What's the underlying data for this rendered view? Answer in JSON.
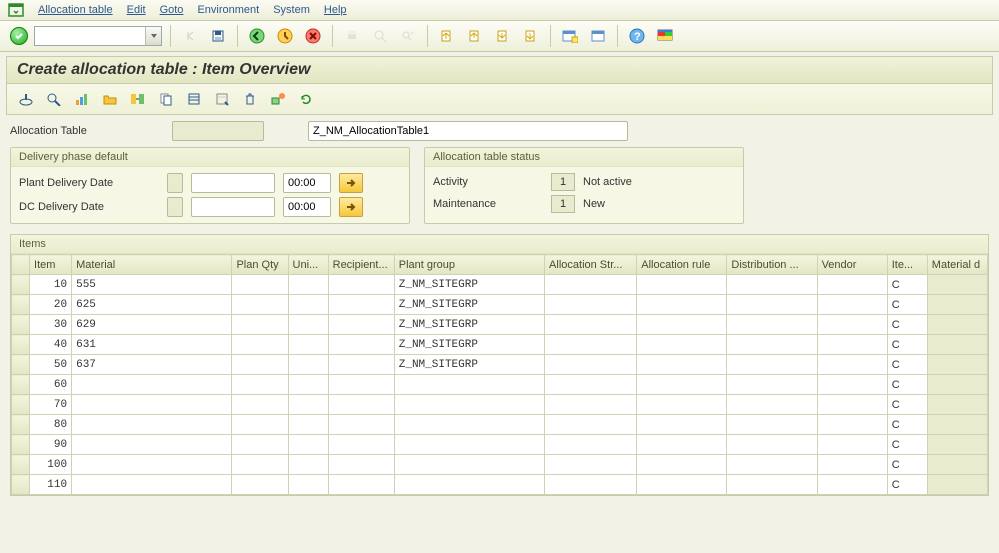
{
  "menu": {
    "items": [
      "Allocation table",
      "Edit",
      "Goto",
      "Environment",
      "System",
      "Help"
    ]
  },
  "toolbar": {
    "combo_value": ""
  },
  "title": "Create allocation table : Item Overview",
  "header": {
    "alloc_table_label": "Allocation Table",
    "alloc_table_code": "",
    "alloc_table_desc": "Z_NM_AllocationTable1"
  },
  "delivery_group": {
    "title": "Delivery phase default",
    "rows": [
      {
        "label": "Plant Delivery Date",
        "date": "",
        "time": "00:00"
      },
      {
        "label": "DC Delivery Date",
        "date": "",
        "time": "00:00"
      }
    ]
  },
  "status_group": {
    "title": "Allocation table status",
    "rows": [
      {
        "label": "Activity",
        "code": "1",
        "text": "Not active"
      },
      {
        "label": "Maintenance",
        "code": "1",
        "text": "New"
      }
    ]
  },
  "items_panel": {
    "title": "Items",
    "columns": [
      "Item",
      "Material",
      "Plan Qty",
      "Uni...",
      "Recipient...",
      "Plant group",
      "Allocation Str...",
      "Allocation rule",
      "Distribution ...",
      "Vendor",
      "Ite...",
      "Material d"
    ],
    "rows": [
      {
        "item": "10",
        "material": "555",
        "plan_qty": "",
        "unit": "",
        "recipient": "",
        "plant_group": "Z_NM_SITEGRP",
        "alloc_str": "",
        "alloc_rule": "",
        "distribution": "",
        "vendor": "",
        "ite": "C",
        "material_d": ""
      },
      {
        "item": "20",
        "material": "625",
        "plan_qty": "",
        "unit": "",
        "recipient": "",
        "plant_group": "Z_NM_SITEGRP",
        "alloc_str": "",
        "alloc_rule": "",
        "distribution": "",
        "vendor": "",
        "ite": "C",
        "material_d": ""
      },
      {
        "item": "30",
        "material": "629",
        "plan_qty": "",
        "unit": "",
        "recipient": "",
        "plant_group": "Z_NM_SITEGRP",
        "alloc_str": "",
        "alloc_rule": "",
        "distribution": "",
        "vendor": "",
        "ite": "C",
        "material_d": ""
      },
      {
        "item": "40",
        "material": "631",
        "plan_qty": "",
        "unit": "",
        "recipient": "",
        "plant_group": "Z_NM_SITEGRP",
        "alloc_str": "",
        "alloc_rule": "",
        "distribution": "",
        "vendor": "",
        "ite": "C",
        "material_d": ""
      },
      {
        "item": "50",
        "material": "637",
        "plan_qty": "",
        "unit": "",
        "recipient": "",
        "plant_group": "Z_NM_SITEGRP",
        "alloc_str": "",
        "alloc_rule": "",
        "distribution": "",
        "vendor": "",
        "ite": "C",
        "material_d": ""
      },
      {
        "item": "60",
        "material": "",
        "plan_qty": "",
        "unit": "",
        "recipient": "",
        "plant_group": "",
        "alloc_str": "",
        "alloc_rule": "",
        "distribution": "",
        "vendor": "",
        "ite": "C",
        "material_d": ""
      },
      {
        "item": "70",
        "material": "",
        "plan_qty": "",
        "unit": "",
        "recipient": "",
        "plant_group": "",
        "alloc_str": "",
        "alloc_rule": "",
        "distribution": "",
        "vendor": "",
        "ite": "C",
        "material_d": ""
      },
      {
        "item": "80",
        "material": "",
        "plan_qty": "",
        "unit": "",
        "recipient": "",
        "plant_group": "",
        "alloc_str": "",
        "alloc_rule": "",
        "distribution": "",
        "vendor": "",
        "ite": "C",
        "material_d": ""
      },
      {
        "item": "90",
        "material": "",
        "plan_qty": "",
        "unit": "",
        "recipient": "",
        "plant_group": "",
        "alloc_str": "",
        "alloc_rule": "",
        "distribution": "",
        "vendor": "",
        "ite": "C",
        "material_d": ""
      },
      {
        "item": "100",
        "material": "",
        "plan_qty": "",
        "unit": "",
        "recipient": "",
        "plant_group": "",
        "alloc_str": "",
        "alloc_rule": "",
        "distribution": "",
        "vendor": "",
        "ite": "C",
        "material_d": ""
      },
      {
        "item": "110",
        "material": "",
        "plan_qty": "",
        "unit": "",
        "recipient": "",
        "plant_group": "",
        "alloc_str": "",
        "alloc_rule": "",
        "distribution": "",
        "vendor": "",
        "ite": "C",
        "material_d": ""
      }
    ]
  }
}
